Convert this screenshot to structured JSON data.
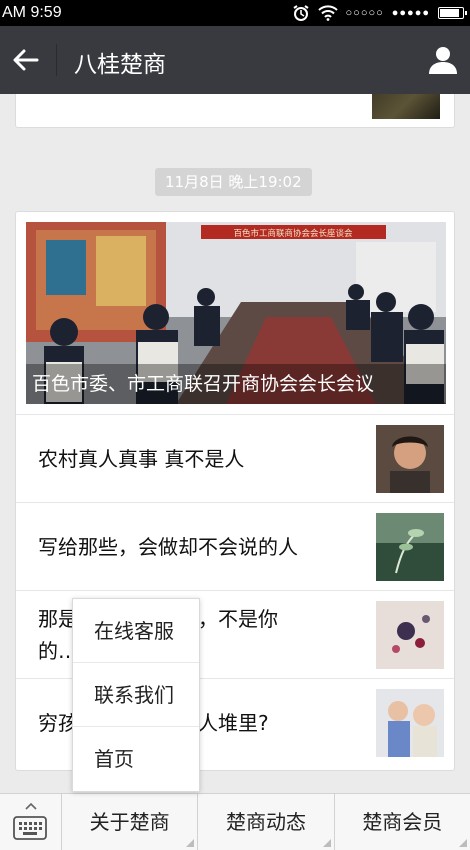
{
  "status_bar": {
    "time": "AM 9:59",
    "signal_dots": "○○○○○",
    "carrier_dots": "●●●●●",
    "battery_level": 0.9
  },
  "nav": {
    "title": "八桂楚商"
  },
  "feed": {
    "timestamp": "11月8日 晚上19:02",
    "cover_title": "百色市委、市工商联召开商协会会长会议",
    "banner_text": "百色市工商联商协会会长座谈会",
    "items": [
      {
        "title": "农村真人真事 真不是人"
      },
      {
        "title": "写给那些，会做却不会说的人"
      },
      {
        "title": "那是",
        "hidden_tail": "钱，不是你",
        "line2": "的…"
      },
      {
        "title": "穷孩",
        "hidden_tail": "富人堆里?"
      }
    ]
  },
  "popup_menu": {
    "items": [
      "在线客服",
      "联系我们",
      "首页"
    ]
  },
  "bottom_menu": {
    "tabs": [
      "关于楚商",
      "楚商动态",
      "楚商会员"
    ]
  }
}
